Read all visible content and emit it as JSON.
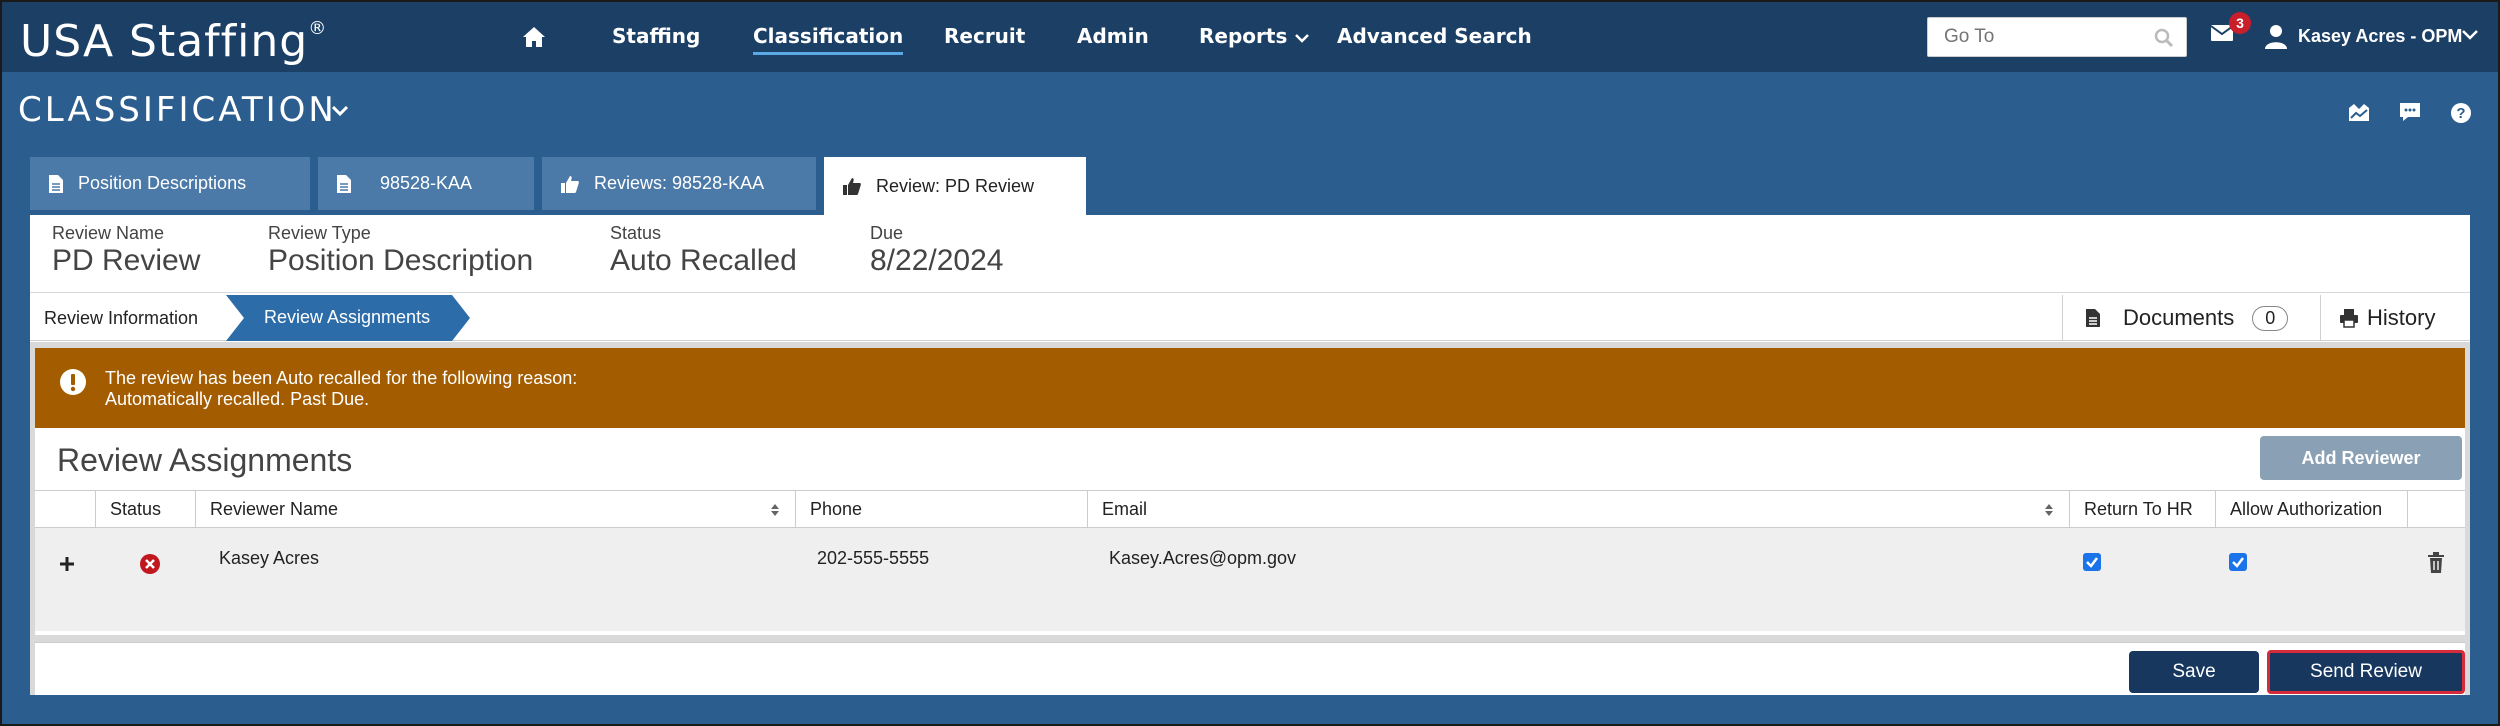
{
  "app": {
    "logo": "USA Staffing",
    "logo_mark": "®"
  },
  "nav": {
    "items": [
      "Staffing",
      "Classification",
      "Recruit",
      "Admin",
      "Reports",
      "Advanced Search"
    ],
    "active": "Classification",
    "goto_placeholder": "Go To",
    "mail_count": "3",
    "user_name": "Kasey Acres - OPM"
  },
  "section": {
    "title": "CLASSIFICATION"
  },
  "tabs": [
    {
      "label": "Position Descriptions",
      "icon": "document-icon"
    },
    {
      "label": "98528-KAA",
      "icon": "document-icon"
    },
    {
      "label": "Reviews: 98528-KAA",
      "icon": "thumbs-up-icon"
    },
    {
      "label": "Review: PD Review",
      "icon": "thumbs-up-icon",
      "active": true
    }
  ],
  "summary": {
    "review_name_label": "Review Name",
    "review_name": "PD Review",
    "review_type_label": "Review Type",
    "review_type": "Position Description",
    "status_label": "Status",
    "status": "Auto Recalled",
    "due_label": "Due",
    "due": "8/22/2024"
  },
  "steps": {
    "info": "Review Information",
    "assignments": "Review Assignments"
  },
  "documents": {
    "label": "Documents",
    "count": "0"
  },
  "history": {
    "label": "History"
  },
  "alert": {
    "line1": "The review has been Auto recalled for the following reason:",
    "line2": "Automatically recalled. Past Due."
  },
  "assignments": {
    "title": "Review Assignments",
    "add_button": "Add Reviewer",
    "columns": [
      "Status",
      "Reviewer Name",
      "Phone",
      "Email",
      "Return To HR",
      "Allow Authorization"
    ],
    "rows": [
      {
        "name": "Kasey Acres",
        "phone": "202-555-5555",
        "email": "Kasey.Acres@opm.gov",
        "return_to_hr": true,
        "allow_authorization": true
      }
    ]
  },
  "footer": {
    "save": "Save",
    "send": "Send Review"
  },
  "colors": {
    "nav": "#1c3f66",
    "body": "#2b5d8e",
    "tab": "#4b7aa8",
    "alert": "#a35d00",
    "primary_btn": "#17375e",
    "focus_ring": "#d62b3b",
    "status_error": "#c0181f"
  }
}
